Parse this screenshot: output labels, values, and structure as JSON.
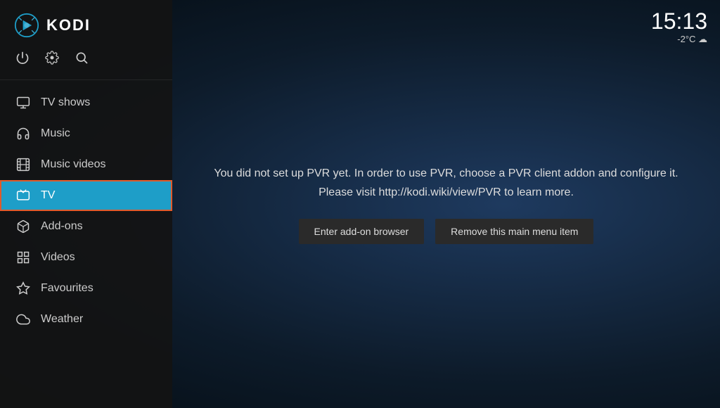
{
  "app": {
    "title": "KODI"
  },
  "clock": {
    "time": "15:13",
    "weather": "-2°C ☁"
  },
  "toolbar": {
    "power_icon": "⏻",
    "settings_icon": "⚙",
    "search_icon": "🔍"
  },
  "nav": {
    "items": [
      {
        "id": "tv-shows",
        "label": "TV shows",
        "icon": "monitor",
        "active": false
      },
      {
        "id": "music",
        "label": "Music",
        "icon": "headphones",
        "active": false
      },
      {
        "id": "music-videos",
        "label": "Music videos",
        "icon": "film",
        "active": false
      },
      {
        "id": "tv",
        "label": "TV",
        "icon": "tv",
        "active": true
      },
      {
        "id": "add-ons",
        "label": "Add-ons",
        "icon": "package",
        "active": false
      },
      {
        "id": "videos",
        "label": "Videos",
        "icon": "grid",
        "active": false
      },
      {
        "id": "favourites",
        "label": "Favourites",
        "icon": "star",
        "active": false
      },
      {
        "id": "weather",
        "label": "Weather",
        "icon": "cloud",
        "active": false
      }
    ]
  },
  "main": {
    "pvr_message": "You did not set up PVR yet. In order to use PVR, choose a PVR client addon and configure it.\nPlease visit http://kodi.wiki/view/PVR to learn more.",
    "pvr_message_line1": "You did not set up PVR yet. In order to use PVR, choose a PVR client addon and configure it.",
    "pvr_message_line2": "Please visit http://kodi.wiki/view/PVR to learn more.",
    "btn_addon_browser": "Enter add-on browser",
    "btn_remove_menu": "Remove this main menu item"
  }
}
